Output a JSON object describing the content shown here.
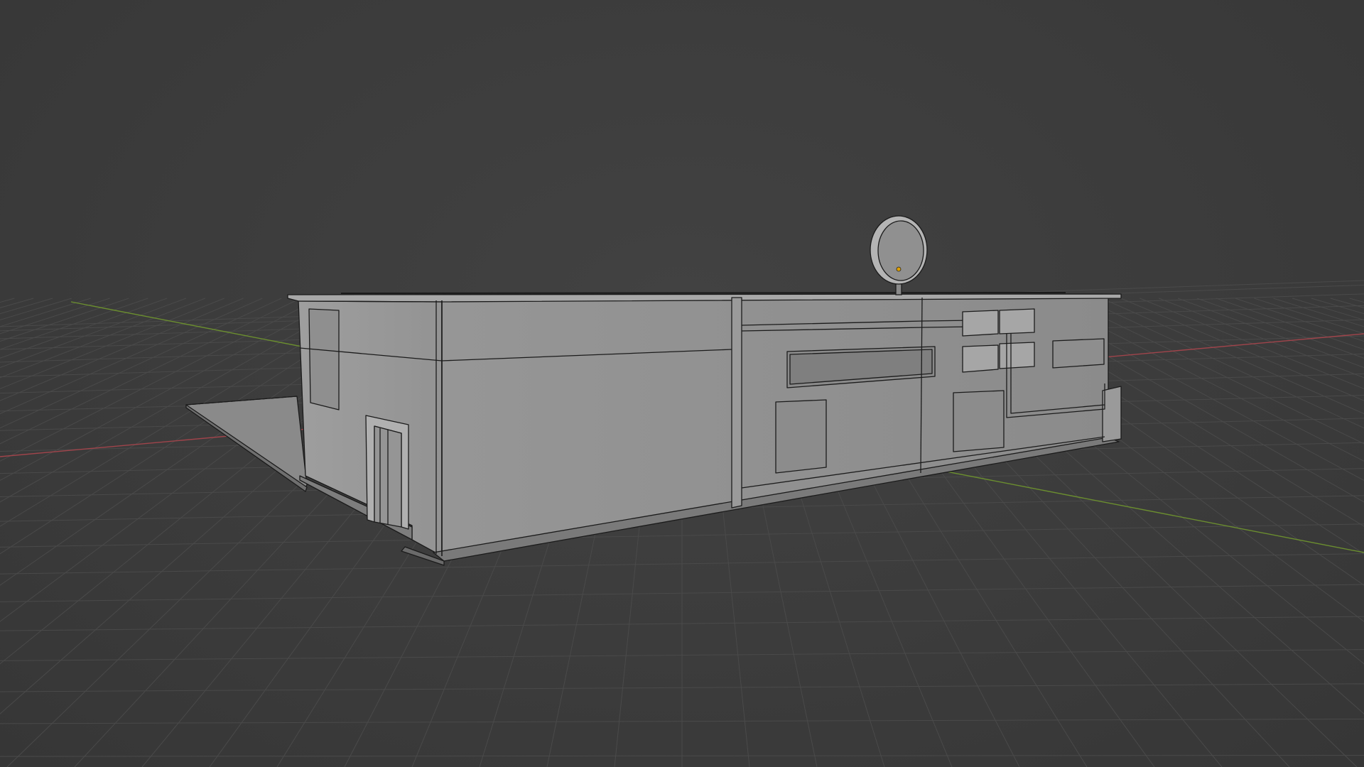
{
  "app": {
    "name": "3D viewport",
    "mode": "object-mode",
    "shading": "solid"
  },
  "viewport": {
    "background_color": "#3d3d3d",
    "grid_color": "#4a4a4a",
    "x_axis_color": "#a0444b",
    "y_axis_color": "#6b8e2f",
    "model_face_color": "#8c8c8c",
    "model_light_face_color": "#a3a3a3",
    "model_dark_face_color": "#6f6f6f",
    "wire_color": "#1b1b1b",
    "origin_color": "#e0a000"
  },
  "scene": {
    "object_name": "building",
    "object_type": "mesh",
    "components": [
      "left-wall",
      "front-wall",
      "roof",
      "sign-disc",
      "door",
      "windows",
      "ground-slab"
    ]
  }
}
